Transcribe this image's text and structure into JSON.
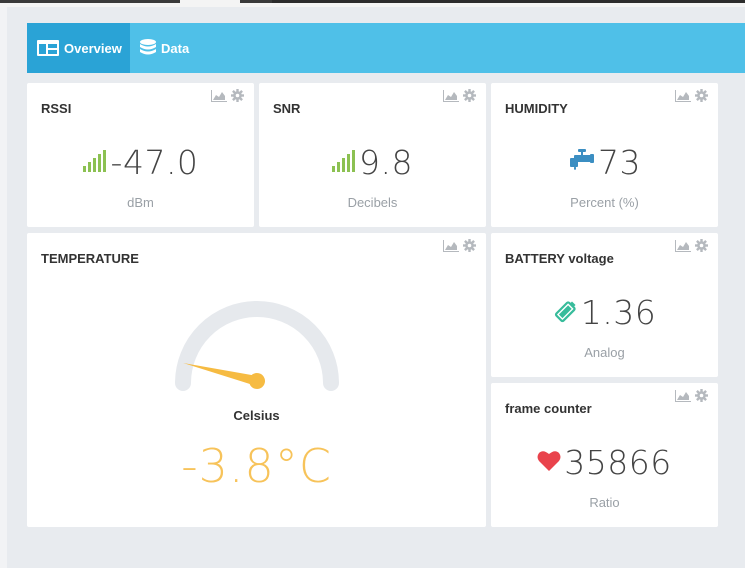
{
  "nav": {
    "tabs": [
      {
        "label": "Overview",
        "icon": "dashboard-icon",
        "active": true
      },
      {
        "label": "Data",
        "icon": "database-icon",
        "active": false
      }
    ]
  },
  "colors": {
    "nav_bg": "#4fc0e8",
    "nav_active": "#2aa3d6",
    "signal_green": "#8cc152",
    "humidity_blue": "#3b8ec2",
    "battery_teal": "#37bc9b",
    "heart_red": "#e9434c",
    "gauge_yellow": "#f6bb42"
  },
  "cards": {
    "rssi": {
      "title": "RSSI",
      "value": "-47.0",
      "unit": "dBm",
      "icon": "signal-bars-icon"
    },
    "snr": {
      "title": "SNR",
      "value": "9.8",
      "unit": "Decibels",
      "icon": "signal-bars-icon"
    },
    "humidity": {
      "title": "HUMIDITY",
      "value": "73",
      "unit": "Percent (%)",
      "icon": "faucet-icon"
    },
    "temperature": {
      "title": "TEMPERATURE",
      "gauge_label": "Celsius",
      "value": "-3.8°C",
      "level": -3.8
    },
    "battery": {
      "title": "BATTERY voltage",
      "value": "1.36",
      "unit": "Analog",
      "icon": "battery-icon"
    },
    "frame": {
      "title": "frame counter",
      "value": "35866",
      "unit": "Ratio",
      "icon": "heart-icon"
    }
  }
}
